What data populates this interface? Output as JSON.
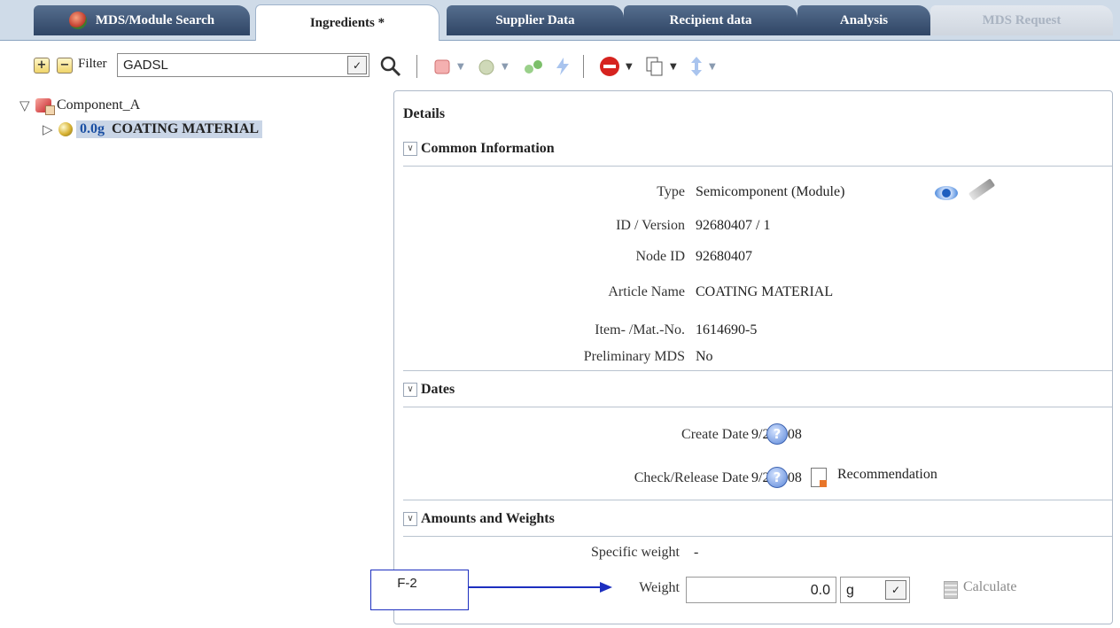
{
  "tabs": [
    {
      "label": "MDS/Module Search",
      "state": "normal"
    },
    {
      "label": "Ingredients *",
      "state": "active"
    },
    {
      "label": "Supplier Data",
      "state": "normal"
    },
    {
      "label": "Recipient data",
      "state": "normal"
    },
    {
      "label": "Analysis",
      "state": "normal"
    },
    {
      "label": "MDS Request",
      "state": "disabled"
    }
  ],
  "toolbar": {
    "expand_symbol": "+",
    "collapse_symbol": "−",
    "filter_label": "Filter",
    "filter_value": "GADSL",
    "dropdown_symbol": "✓"
  },
  "tree": {
    "root": {
      "label": "Component_A",
      "twisty": "▽",
      "icon": "component-cube-icon"
    },
    "child": {
      "amount": "0.0g",
      "label": "COATING MATERIAL",
      "twisty": "▷",
      "icon": "module-ball-icon"
    }
  },
  "details": {
    "title": "Details",
    "sections": {
      "common": {
        "title": "Common Information"
      },
      "dates": {
        "title": "Dates"
      },
      "amounts": {
        "title": "Amounts and Weights"
      }
    },
    "common": {
      "type_label": "Type",
      "type_value": "Semicomponent (Module)",
      "id_label": "ID / Version",
      "id_value": "92680407 / 1",
      "node_label": "Node ID",
      "node_value": "92680407",
      "article_label": "Article Name",
      "article_value": "COATING MATERIAL",
      "item_label": "Item- /Mat.-No.",
      "item_value": "1614690-5",
      "prelim_label": "Preliminary MDS",
      "prelim_value": "No"
    },
    "dates": {
      "create_label": "Create Date",
      "create_value": "9/2/2008",
      "check_label": "Check/Release Date",
      "check_value": "9/2/2008",
      "recommendation": "Recommendation",
      "help_symbol": "?"
    },
    "amounts": {
      "specific_label": "Specific weight",
      "specific_value": "-",
      "weight_label": "Weight",
      "weight_value": "0.0",
      "unit_value": "g",
      "calculate_label": "Calculate"
    }
  },
  "annotation": {
    "label": "F-2"
  },
  "colors": {
    "accent": "#1d2fbf",
    "tab_dark": "#3a5070",
    "selection": "#c9d5e6"
  }
}
